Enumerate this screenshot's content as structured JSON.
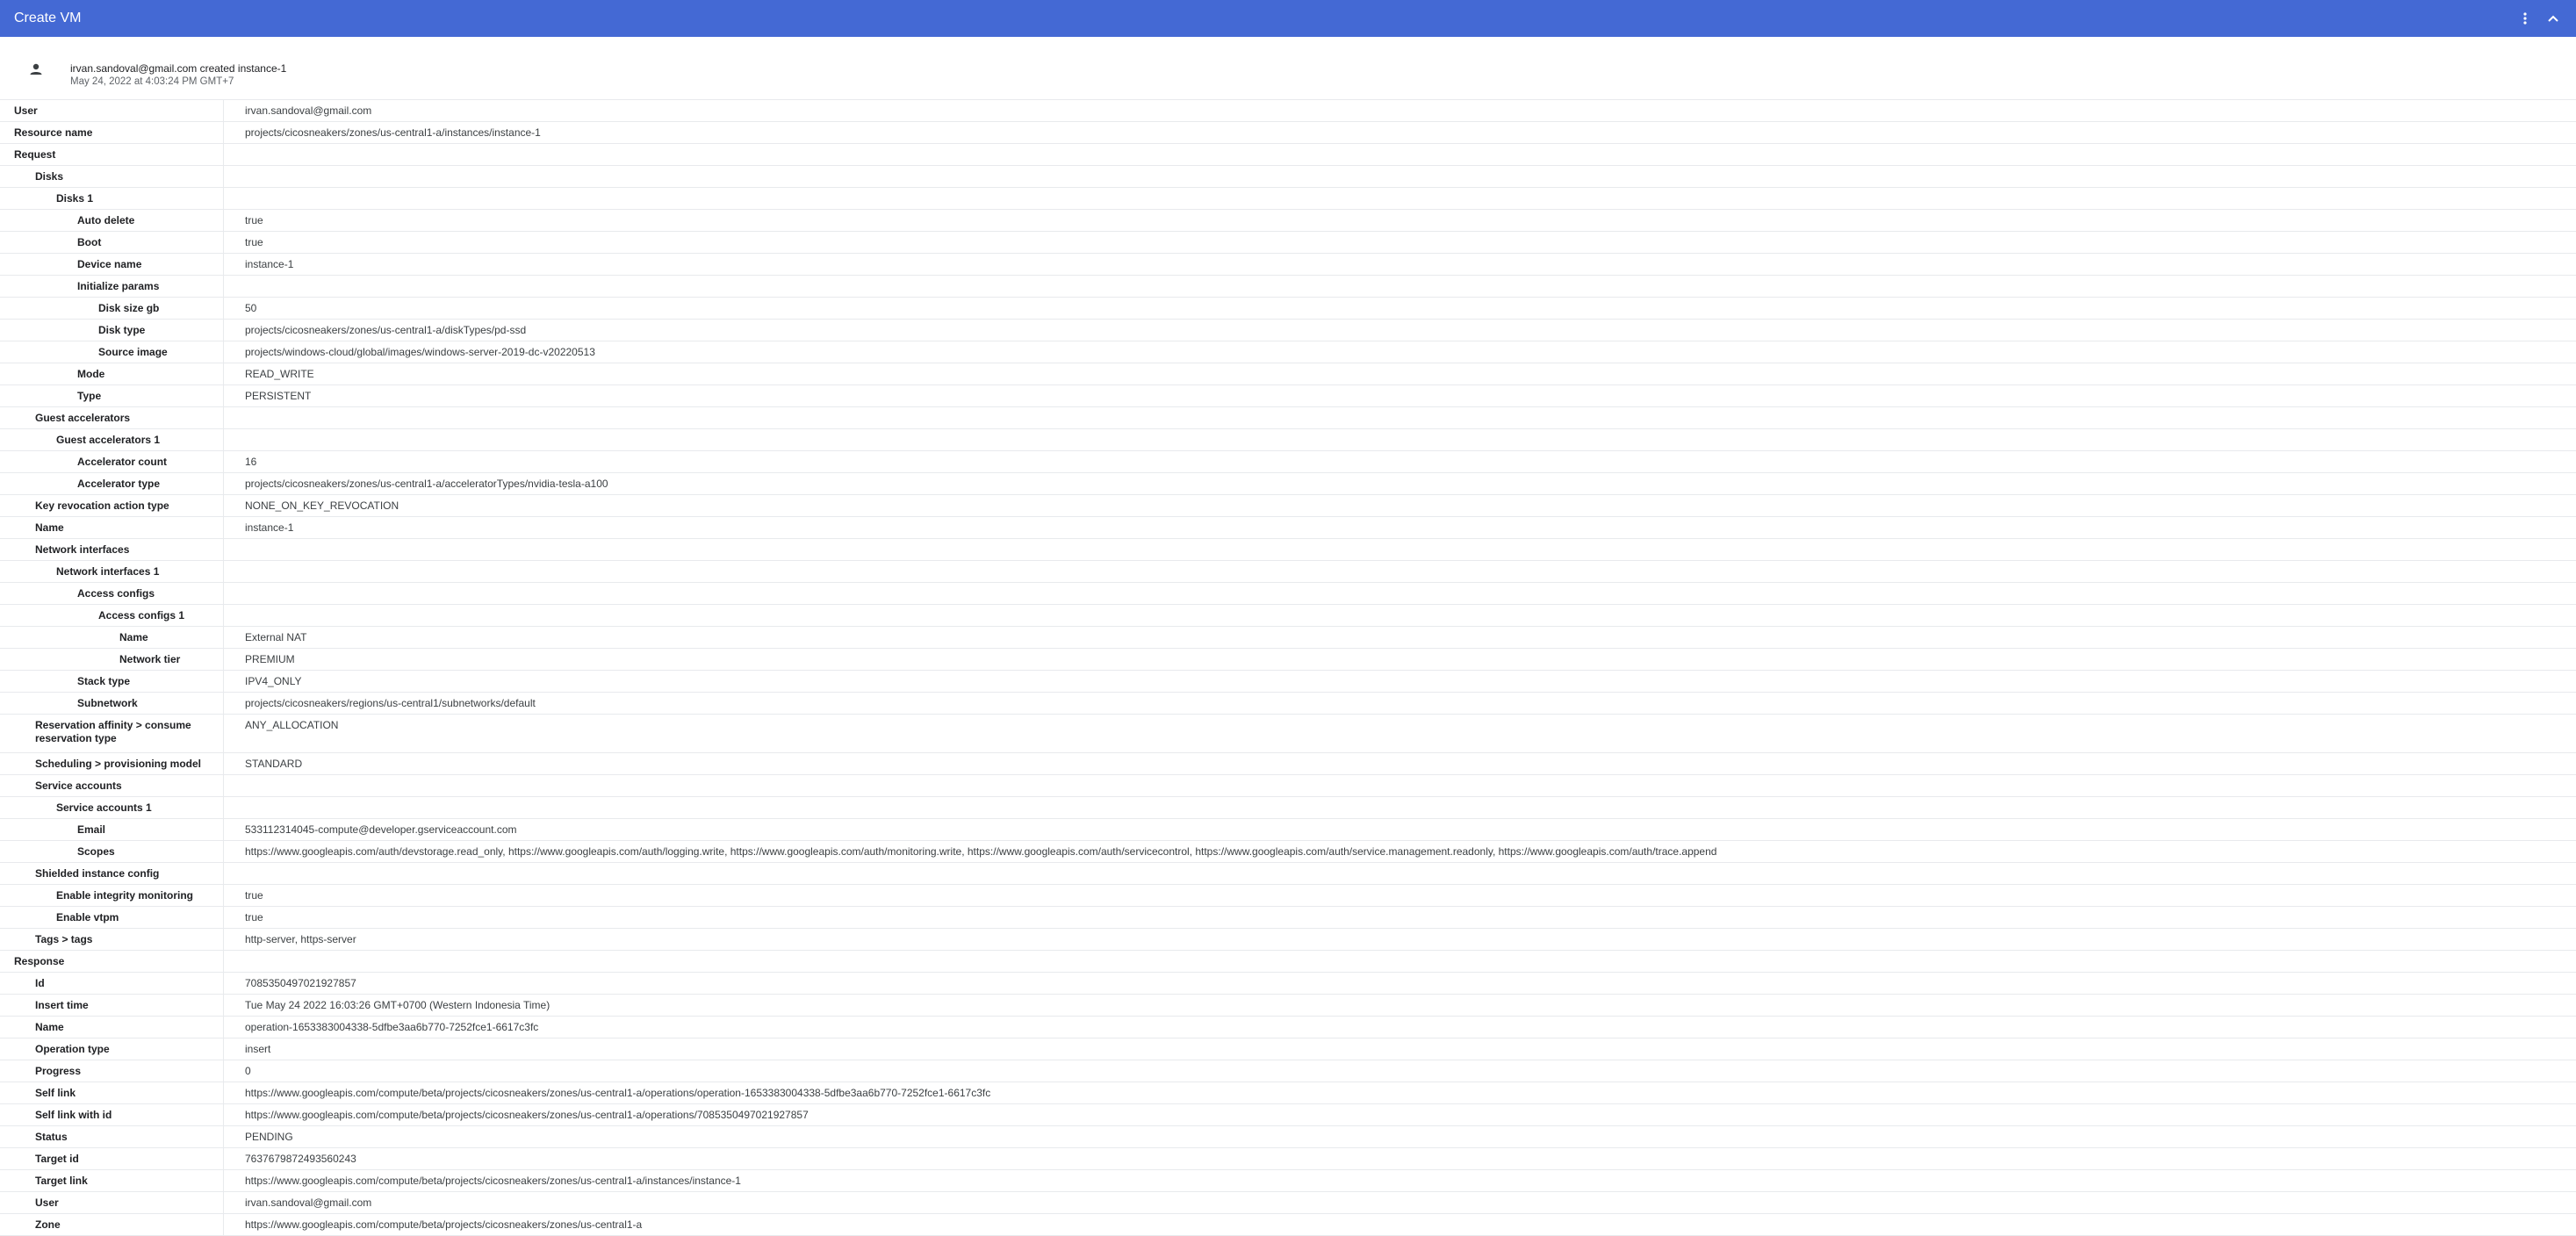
{
  "window": {
    "title": "Create VM",
    "menu_icon": "more-vert-icon",
    "collapse_icon": "chevron-up-icon"
  },
  "header": {
    "avatar_icon": "person-icon",
    "summary": "irvan.sandoval@gmail.com created instance-1",
    "timestamp": "May 24, 2022 at 4:03:24 PM GMT+7"
  },
  "rows": [
    {
      "key": "User",
      "value": "irvan.sandoval@gmail.com",
      "level": 0
    },
    {
      "key": "Resource name",
      "value": "projects/cicosneakers/zones/us-central1-a/instances/instance-1",
      "level": 0
    },
    {
      "key": "Request",
      "value": "",
      "level": 0
    },
    {
      "key": "Disks",
      "value": "",
      "level": 1
    },
    {
      "key": "Disks 1",
      "value": "",
      "level": 2
    },
    {
      "key": "Auto delete",
      "value": "true",
      "level": 3
    },
    {
      "key": "Boot",
      "value": "true",
      "level": 3
    },
    {
      "key": "Device name",
      "value": "instance-1",
      "level": 3
    },
    {
      "key": "Initialize params",
      "value": "",
      "level": 3
    },
    {
      "key": "Disk size gb",
      "value": "50",
      "level": 4
    },
    {
      "key": "Disk type",
      "value": "projects/cicosneakers/zones/us-central1-a/diskTypes/pd-ssd",
      "level": 4
    },
    {
      "key": "Source image",
      "value": "projects/windows-cloud/global/images/windows-server-2019-dc-v20220513",
      "level": 4
    },
    {
      "key": "Mode",
      "value": "READ_WRITE",
      "level": 3
    },
    {
      "key": "Type",
      "value": "PERSISTENT",
      "level": 3
    },
    {
      "key": "Guest accelerators",
      "value": "",
      "level": 1
    },
    {
      "key": "Guest accelerators 1",
      "value": "",
      "level": 2
    },
    {
      "key": "Accelerator count",
      "value": "16",
      "level": 3
    },
    {
      "key": "Accelerator type",
      "value": "projects/cicosneakers/zones/us-central1-a/acceleratorTypes/nvidia-tesla-a100",
      "level": 3
    },
    {
      "key": "Key revocation action type",
      "value": "NONE_ON_KEY_REVOCATION",
      "level": 1
    },
    {
      "key": "Name",
      "value": "instance-1",
      "level": 1
    },
    {
      "key": "Network interfaces",
      "value": "",
      "level": 1
    },
    {
      "key": "Network interfaces 1",
      "value": "",
      "level": 2
    },
    {
      "key": "Access configs",
      "value": "",
      "level": 3
    },
    {
      "key": "Access configs 1",
      "value": "",
      "level": 4
    },
    {
      "key": "Name",
      "value": "External NAT",
      "level": 5
    },
    {
      "key": "Network tier",
      "value": "PREMIUM",
      "level": 5
    },
    {
      "key": "Stack type",
      "value": "IPV4_ONLY",
      "level": 3
    },
    {
      "key": "Subnetwork",
      "value": "projects/cicosneakers/regions/us-central1/subnetworks/default",
      "level": 3
    },
    {
      "key": "Reservation affinity > consume reservation type",
      "value": "ANY_ALLOCATION",
      "level": 1,
      "tall": true
    },
    {
      "key": "Scheduling > provisioning model",
      "value": "STANDARD",
      "level": 1
    },
    {
      "key": "Service accounts",
      "value": "",
      "level": 1
    },
    {
      "key": "Service accounts 1",
      "value": "",
      "level": 2
    },
    {
      "key": "Email",
      "value": "533112314045-compute@developer.gserviceaccount.com",
      "level": 3
    },
    {
      "key": "Scopes",
      "value": "https://www.googleapis.com/auth/devstorage.read_only, https://www.googleapis.com/auth/logging.write, https://www.googleapis.com/auth/monitoring.write, https://www.googleapis.com/auth/servicecontrol, https://www.googleapis.com/auth/service.management.readonly, https://www.googleapis.com/auth/trace.append",
      "level": 3
    },
    {
      "key": "Shielded instance config",
      "value": "",
      "level": 1
    },
    {
      "key": "Enable integrity monitoring",
      "value": "true",
      "level": 2
    },
    {
      "key": "Enable vtpm",
      "value": "true",
      "level": 2
    },
    {
      "key": "Tags > tags",
      "value": "http-server, https-server",
      "level": 1
    },
    {
      "key": "Response",
      "value": "",
      "level": 0
    },
    {
      "key": "Id",
      "value": "7085350497021927857",
      "level": 1
    },
    {
      "key": "Insert time",
      "value": "Tue May 24 2022 16:03:26 GMT+0700 (Western Indonesia Time)",
      "level": 1
    },
    {
      "key": "Name",
      "value": "operation-1653383004338-5dfbe3aa6b770-7252fce1-6617c3fc",
      "level": 1
    },
    {
      "key": "Operation type",
      "value": "insert",
      "level": 1
    },
    {
      "key": "Progress",
      "value": "0",
      "level": 1
    },
    {
      "key": "Self link",
      "value": "https://www.googleapis.com/compute/beta/projects/cicosneakers/zones/us-central1-a/operations/operation-1653383004338-5dfbe3aa6b770-7252fce1-6617c3fc",
      "level": 1
    },
    {
      "key": "Self link with id",
      "value": "https://www.googleapis.com/compute/beta/projects/cicosneakers/zones/us-central1-a/operations/7085350497021927857",
      "level": 1
    },
    {
      "key": "Status",
      "value": "PENDING",
      "level": 1
    },
    {
      "key": "Target id",
      "value": "7637679872493560243",
      "level": 1
    },
    {
      "key": "Target link",
      "value": "https://www.googleapis.com/compute/beta/projects/cicosneakers/zones/us-central1-a/instances/instance-1",
      "level": 1
    },
    {
      "key": "User",
      "value": "irvan.sandoval@gmail.com",
      "level": 1
    },
    {
      "key": "Zone",
      "value": "https://www.googleapis.com/compute/beta/projects/cicosneakers/zones/us-central1-a",
      "level": 1
    }
  ]
}
